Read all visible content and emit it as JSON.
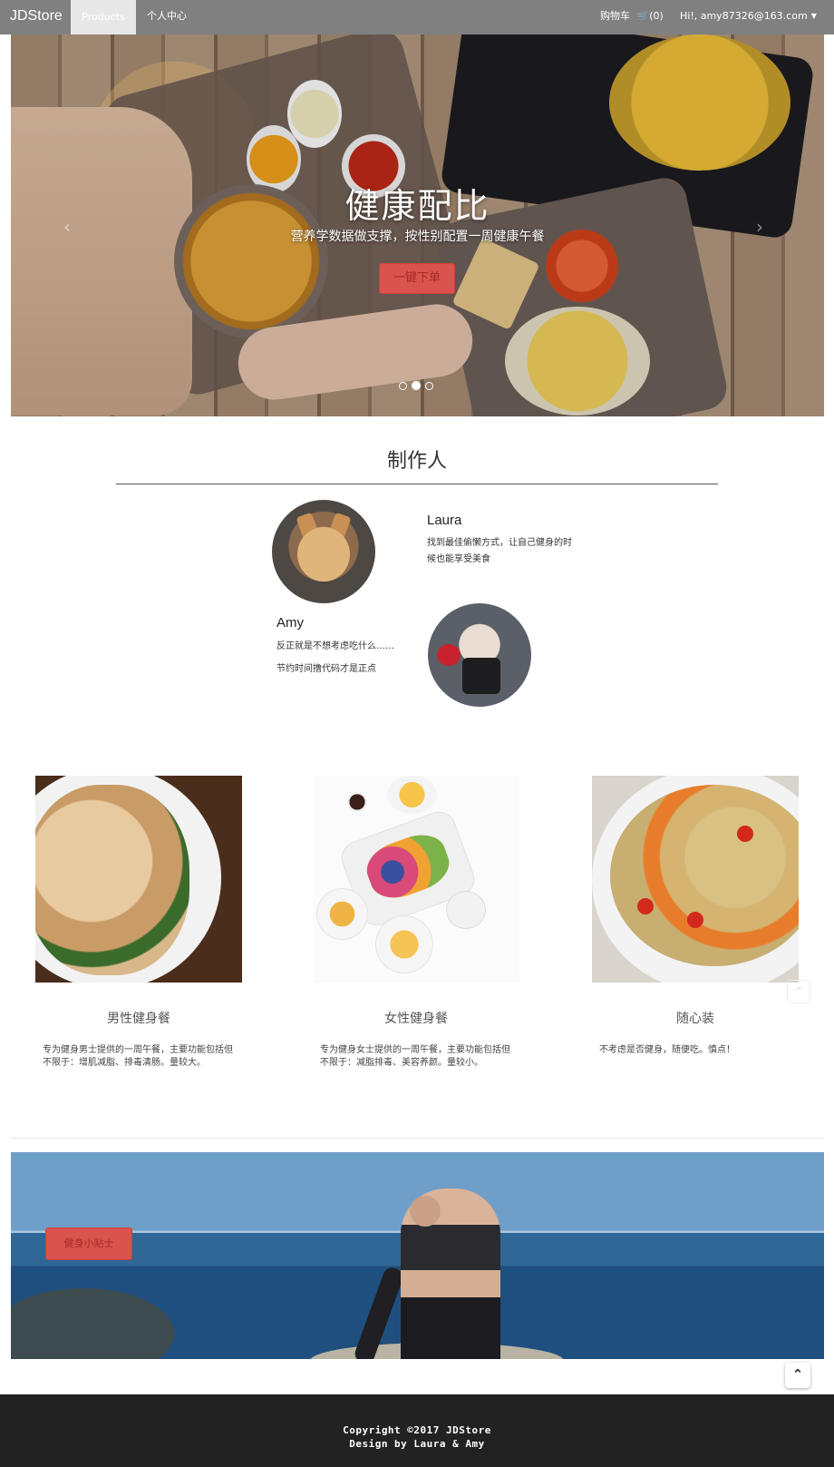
{
  "navbar": {
    "brand": "JDStore",
    "tabs": [
      {
        "label": "Products",
        "active": true
      },
      {
        "label": "个人中心",
        "active": false
      }
    ],
    "cart_label": "购物车",
    "cart_count": "(0)",
    "cart_icon": "shopping-cart-icon",
    "user_greeting": "Hi!, amy87326@163.com",
    "dropdown_icon": "caret-down-icon"
  },
  "hero": {
    "title": "健康配比",
    "subtitle": "营养学数据做支撑，按性别配置一周健康午餐",
    "button_label": "一键下单",
    "prev_icon": "chevron-left-icon",
    "next_icon": "chevron-right-icon",
    "slide_count": 3,
    "active_slide": 2
  },
  "makers": {
    "title": "制作人",
    "people": [
      {
        "name": "Laura",
        "desc": "找到最佳偷懒方式，让自己健身的时候也能享受美食"
      },
      {
        "name": "Amy",
        "desc_line1": "反正就是不想考虑吃什么……",
        "desc_line2": "节约时间撸代码才是正点"
      }
    ]
  },
  "products": [
    {
      "title": "男性健身餐",
      "desc": "专为健身男士提供的一周午餐，主要功能包括但不限于：增肌减脂、排毒清肠。量较大。"
    },
    {
      "title": "女性健身餐",
      "desc": "专为健身女士提供的一周午餐，主要功能包括但不限于：减脂排毒、美容养颜。量较小。"
    },
    {
      "title": "随心装",
      "desc": "不考虑是否健身，随便吃。慎点！"
    }
  ],
  "banner": {
    "button_label": "健身小贴士"
  },
  "back_to_top_icon": "chevron-up-icon",
  "footer": {
    "copyright": "Copyright ©2017 JDStore",
    "credit": "Design by Laura & Amy"
  },
  "colors": {
    "navbar_bg": "#808080",
    "accent_red": "#d9534f",
    "footer_bg": "#222222"
  }
}
